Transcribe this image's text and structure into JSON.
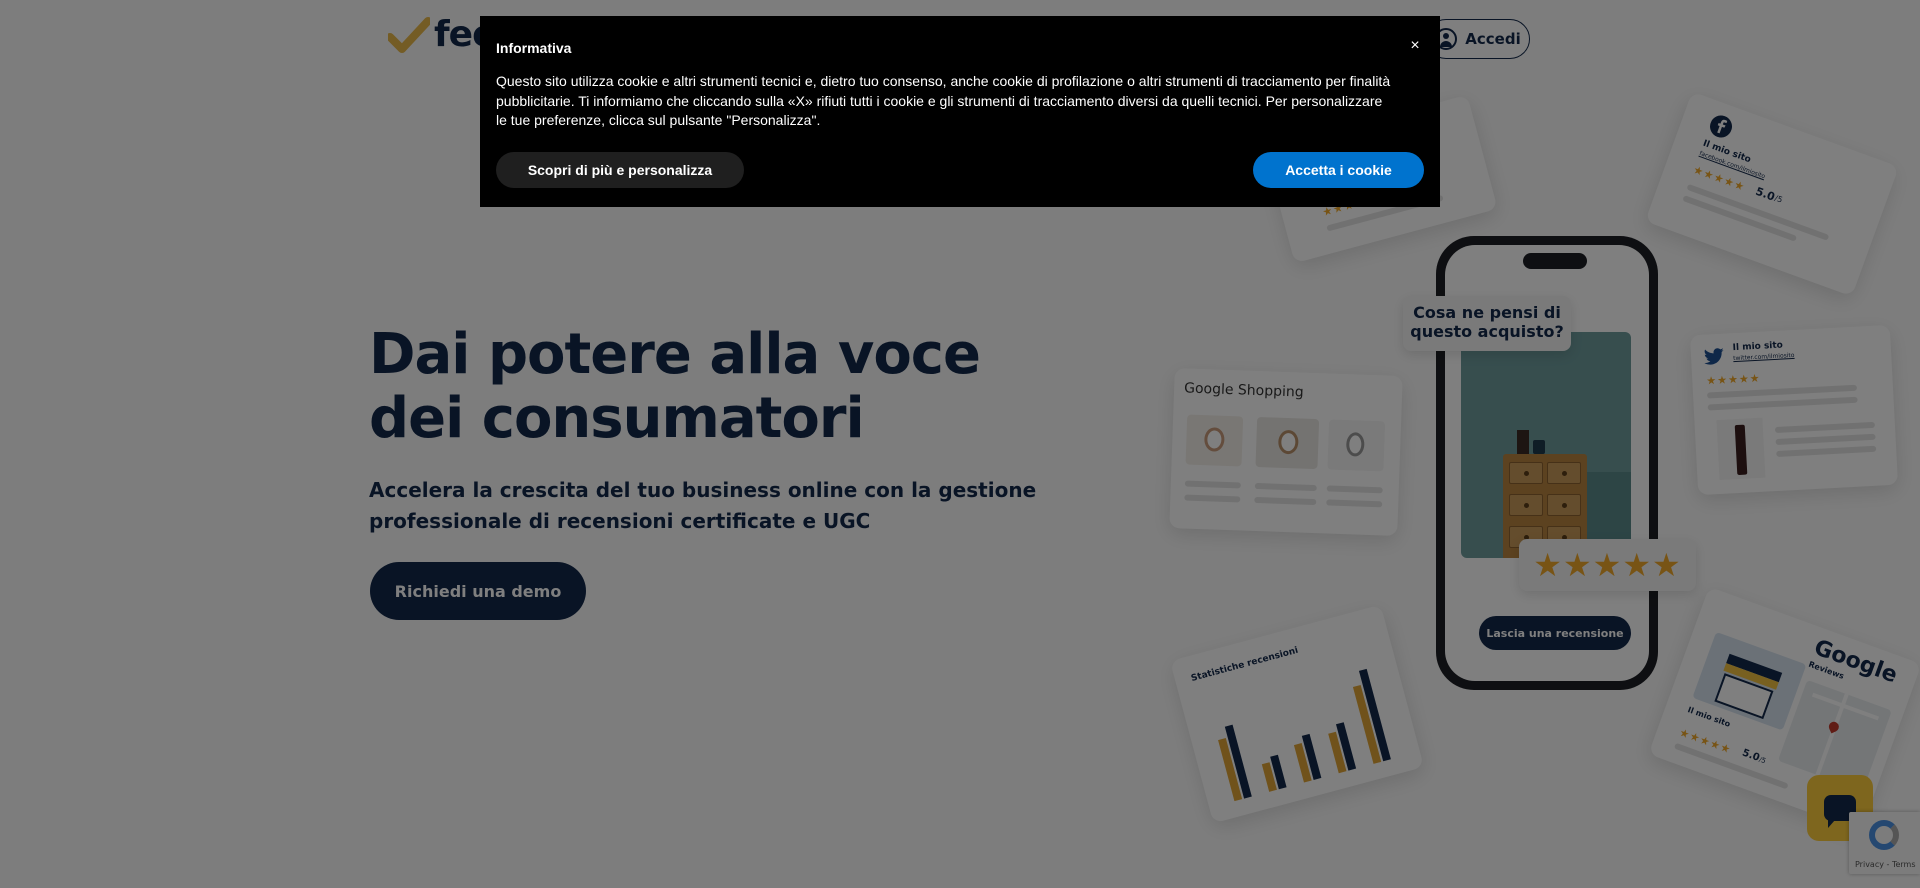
{
  "header": {
    "logo_text": "fee",
    "login_label": "Accedi"
  },
  "hero": {
    "title": "Dai potere alla voce dei consumatori",
    "subtitle": "Accelera la crescita del tuo business online con la gestione professionale di recensioni certificate e UGC",
    "cta_label": "Richiedi una demo"
  },
  "visual": {
    "bubble_text": "Cosa ne pensi di questo acquisto?",
    "leave_review_label": "Lascia una recensione",
    "stars": "★★★★★",
    "google_shopping_label": "Google Shopping",
    "stats_label": "Statistiche recensioni",
    "google_reviews_label": "Google",
    "google_reviews_sub": "Reviews",
    "site_label": "Il mio sito",
    "facebook_url": "facebook.com/ilmiosito",
    "twitter_url": "twitter.com/ilmiosito",
    "rating_value": "5.0",
    "rating_max": "/5",
    "chart_heights": [
      0.62,
      0.28,
      0.38,
      0.4,
      0.78
    ]
  },
  "cookie": {
    "title": "Informativa",
    "close_label": "×",
    "text": "Questo sito utilizza cookie e altri strumenti tecnici e, dietro tuo consenso, anche cookie di profilazione o altri strumenti di tracciamento per finalità pubblicitarie. Ti informiamo che cliccando sulla «X» rifiuti tutti i cookie e gli strumenti di tracciamento diversi da quelli tecnici. Per personalizzare le tue preferenze, clicca sul pulsante \"Personalizza\".",
    "more_label": "Scopri di più e personalizza",
    "accept_label": "Accetta i cookie"
  },
  "recaptcha": {
    "footer": "Privacy - Terms"
  },
  "colors": {
    "brand_navy": "#13294b",
    "accent_yellow": "#fccc3c",
    "star_gold": "#f0a92a",
    "accept_blue": "#0073ce"
  }
}
